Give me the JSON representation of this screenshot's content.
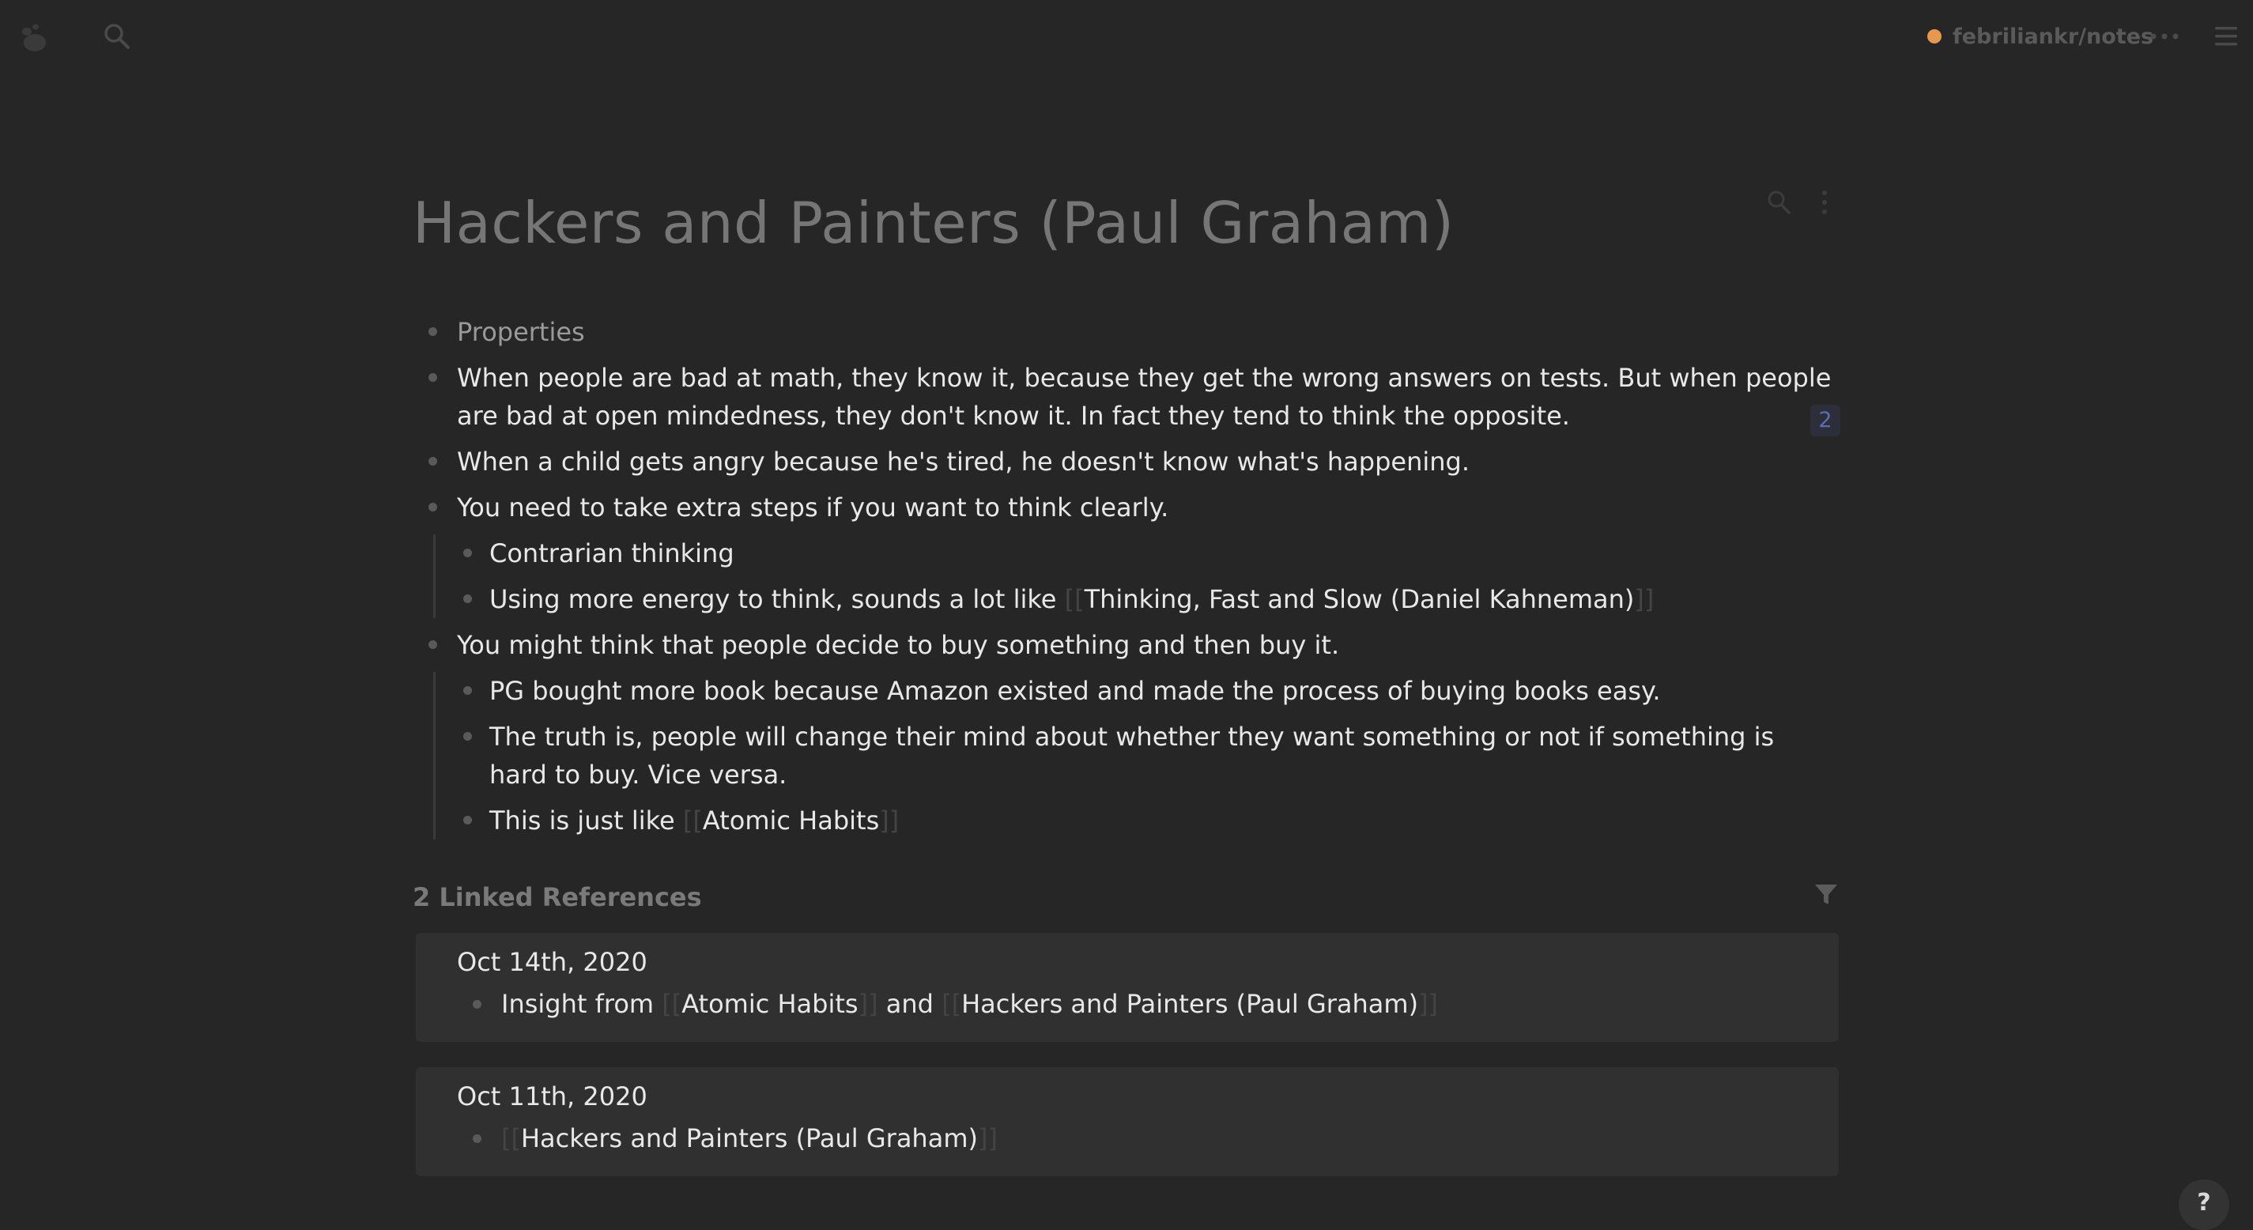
{
  "topbar": {
    "repo": "febriliankr/notes",
    "sync_status_color": "#e7984f",
    "icons": [
      "logseq-logo-icon",
      "search-icon",
      "more-horizontal-icon",
      "menu-icon"
    ]
  },
  "page": {
    "title": "Hackers and Painters (Paul Graham)",
    "blocks": {
      "properties": "Properties",
      "b1": "When people are bad at math, they know it, because they get the wrong answers on tests. But when people are bad at open mindedness, they don't know it. In fact they tend to think the opposite.",
      "b2": "When a child gets angry because he's tired, he doesn't know what's happening.",
      "b3": "You need to take extra steps if you want to think clearly.",
      "b3_1": "Contrarian thinking",
      "b3_2_text": "Using more energy to think, sounds a lot like ",
      "b3_2_link": "Thinking, Fast and Slow (Daniel Kahneman)",
      "b4": "You might think that people decide to buy something and then buy it.",
      "b4_1": "PG bought more book because Amazon existed and made the process of buying books easy.",
      "b4_2": "The truth is, people will change their mind about whether they want something or not if something is hard to buy. Vice versa.",
      "b4_2_ref_count": "2",
      "b4_3_text": "This is just like ",
      "b4_3_link": "Atomic Habits"
    },
    "bracket_open": "[[",
    "bracket_close": "]]"
  },
  "linked_references": {
    "header": "2 Linked References",
    "refs": [
      {
        "date": "Oct 14th, 2020",
        "text_before": "Insight from ",
        "link1": "Atomic Habits",
        "text_between": " and ",
        "link2": "Hackers and Painters (Paul Graham)"
      },
      {
        "date": "Oct 11th, 2020",
        "link1": "Hackers and Painters (Paul Graham)"
      }
    ]
  },
  "help": {
    "label": "?"
  }
}
